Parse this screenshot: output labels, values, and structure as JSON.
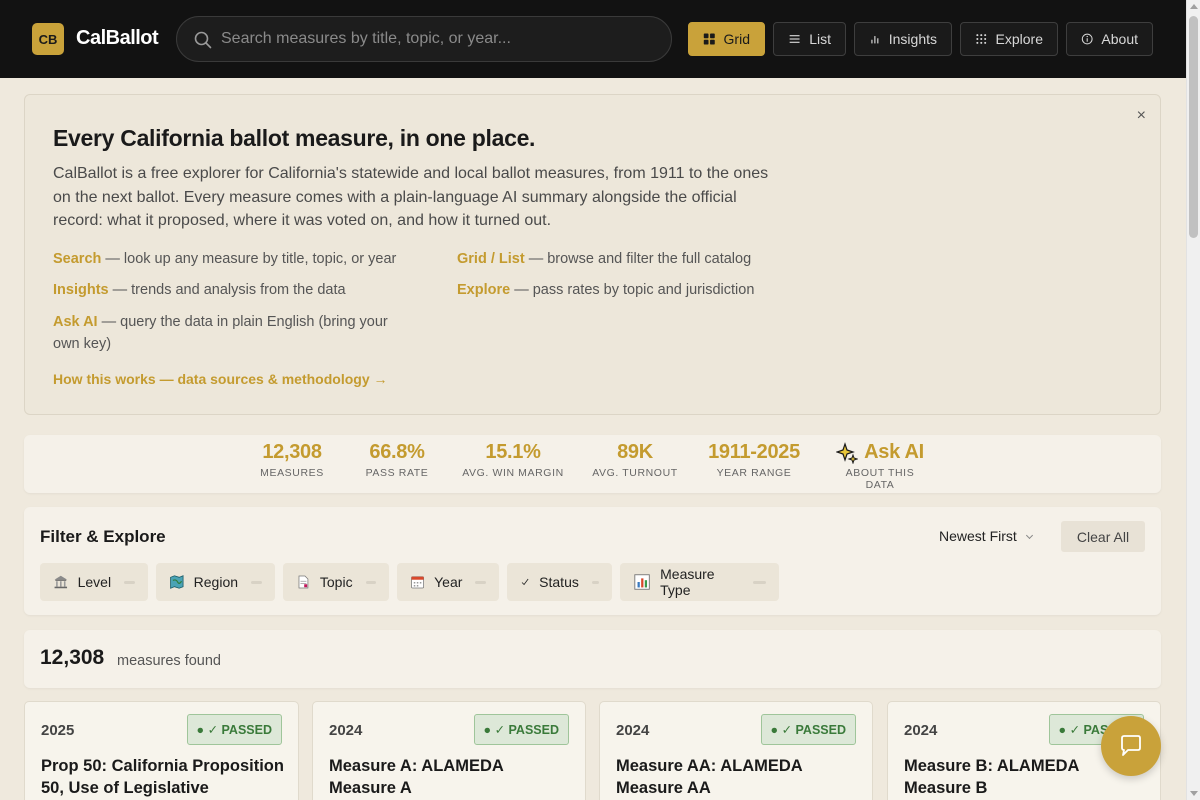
{
  "brand": {
    "badge": "CB",
    "name": "CalBallot"
  },
  "search": {
    "placeholder": "Search measures by title, topic, or year..."
  },
  "nav": {
    "grid": "Grid",
    "list": "List",
    "insights": "Insights",
    "explore": "Explore",
    "about": "About"
  },
  "intro": {
    "title": "Every California ballot measure, in one place.",
    "lead": "CalBallot is a free explorer for California's statewide and local ballot measures, from 1911 to the ones on the next ballot. Every measure comes with a plain-language AI summary alongside the official record: what it proposed, where it was voted on, and how it turned out.",
    "features": [
      {
        "key": "Search",
        "text": " — look up any measure by title, topic, or year"
      },
      {
        "key": "Grid / List",
        "text": " — browse and filter the full catalog"
      },
      {
        "key": "Insights",
        "text": " — trends and analysis from the data"
      },
      {
        "key": "Explore",
        "text": " — pass rates by topic and jurisdiction"
      },
      {
        "key": "Ask AI",
        "text": " — query the data in plain English (bring your own key)"
      }
    ],
    "how_link": "How this works — data sources & methodology →",
    "close": "×"
  },
  "stats": [
    {
      "value": "12,308",
      "label": "MEASURES"
    },
    {
      "value": "66.8%",
      "label": "PASS RATE"
    },
    {
      "value": "15.1%",
      "label": "AVG. WIN MARGIN"
    },
    {
      "value": "89K",
      "label": "AVG. TURNOUT"
    },
    {
      "value": "1911-2025",
      "label": "YEAR RANGE"
    },
    {
      "value": "Ask AI",
      "label": "ABOUT THIS DATA"
    }
  ],
  "filter": {
    "title": "Filter & Explore",
    "sort": "Newest First",
    "clear": "Clear All",
    "chips": [
      "Level",
      "Region",
      "Topic",
      "Year",
      "Status",
      "Measure Type"
    ]
  },
  "results": {
    "count": "12,308",
    "label": "measures found"
  },
  "cards": [
    {
      "year": "2025",
      "status": "● ✓ PASSED",
      "title": "Prop 50: California Proposition 50, Use of Legislative"
    },
    {
      "year": "2024",
      "status": "● ✓ PASSED",
      "title": "Measure A: ALAMEDA Measure A"
    },
    {
      "year": "2024",
      "status": "● ✓ PASSED",
      "title": "Measure AA: ALAMEDA Measure AA"
    },
    {
      "year": "2024",
      "status": "● ✓ PASSED",
      "title": "Measure B: ALAMEDA Measure B"
    }
  ],
  "colors": {
    "accent": "#c9a23a",
    "topbar": "#121212",
    "passed": "#3a7a3a"
  }
}
